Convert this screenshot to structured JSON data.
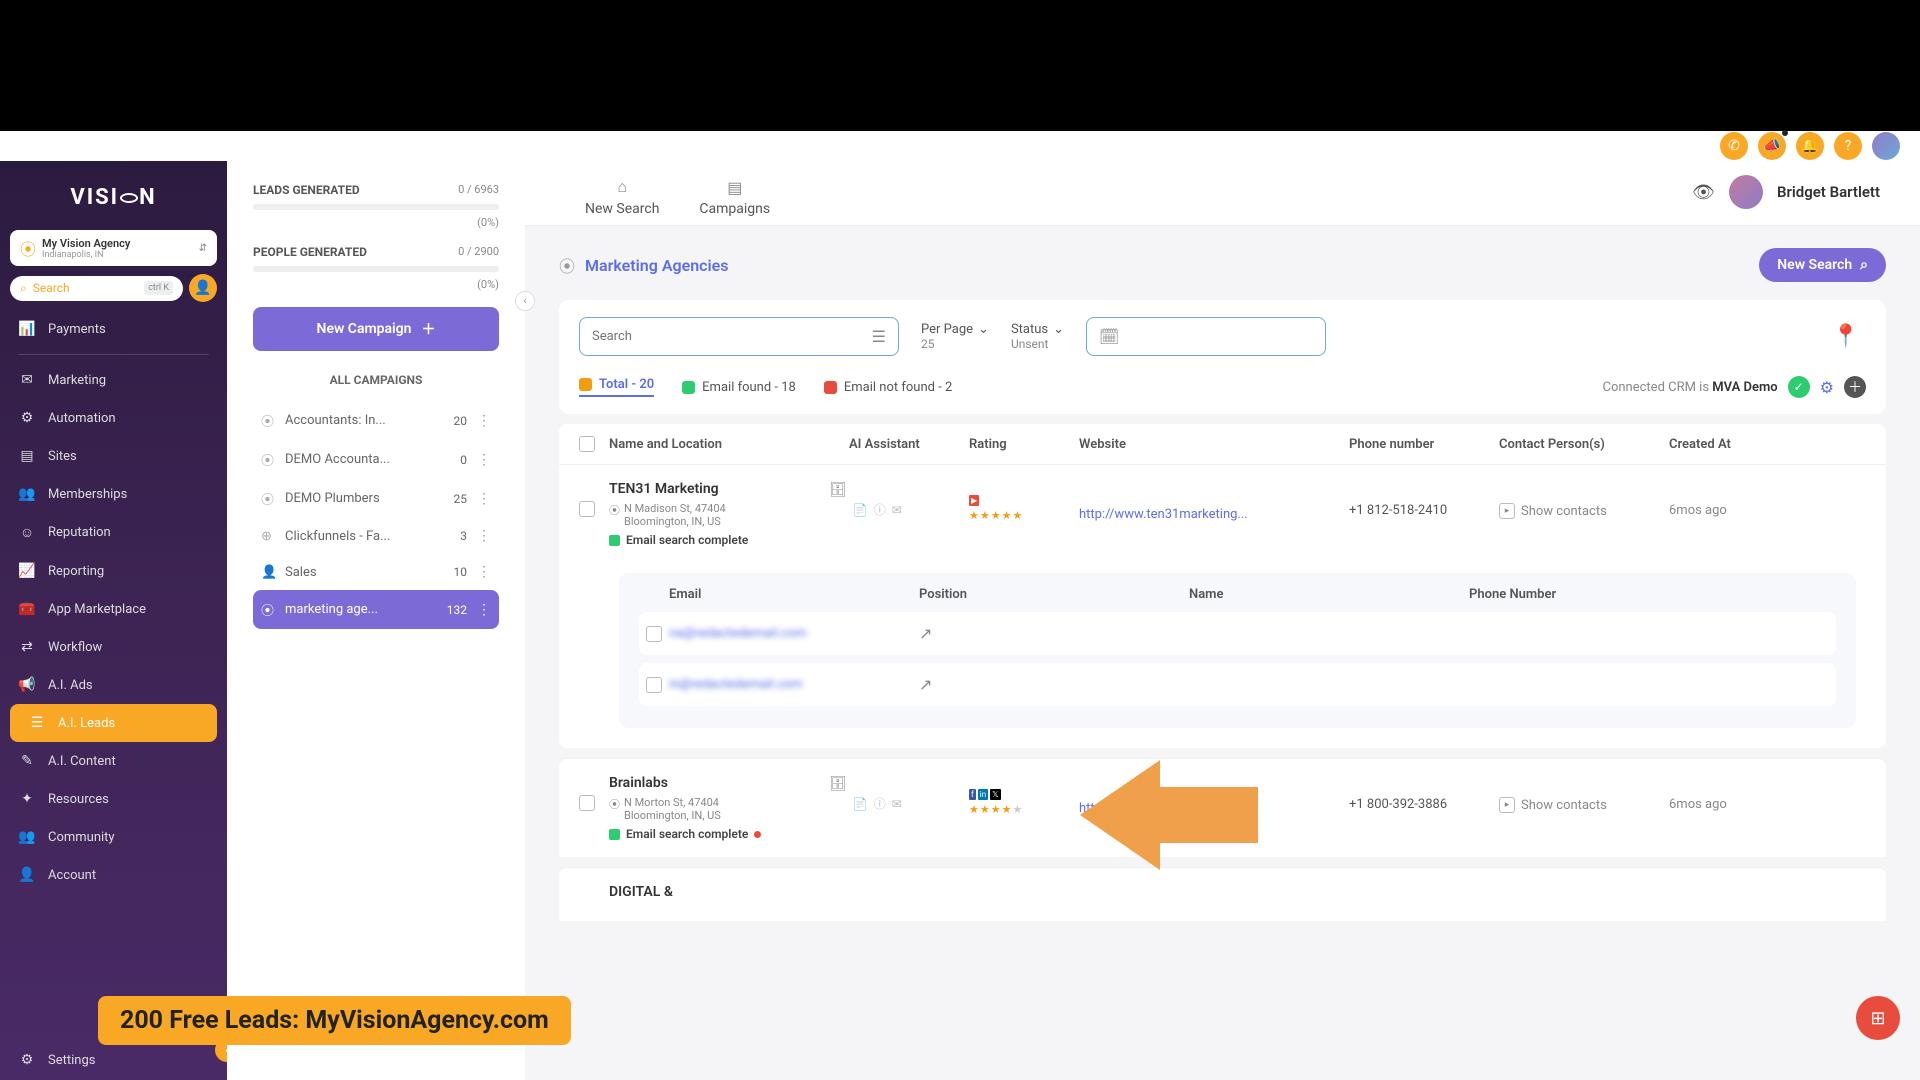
{
  "brand": "VISION",
  "agency": {
    "name": "My Vision Agency",
    "location": "Indianapolis, IN"
  },
  "search": {
    "placeholder": "Search",
    "shortcut": "ctrl K"
  },
  "nav": {
    "payments": "Payments",
    "marketing": "Marketing",
    "automation": "Automation",
    "sites": "Sites",
    "memberships": "Memberships",
    "reputation": "Reputation",
    "reporting": "Reporting",
    "marketplace": "App Marketplace",
    "workflow": "Workflow",
    "aiads": "A.I. Ads",
    "aileads": "A.I. Leads",
    "aicontent": "A.I. Content",
    "resources": "Resources",
    "community": "Community",
    "account": "Account",
    "settings": "Settings"
  },
  "campaigns_panel": {
    "leads_generated": {
      "label": "LEADS GENERATED",
      "value": "0 / 6963",
      "pct": "(0%)"
    },
    "people_generated": {
      "label": "PEOPLE GENERATED",
      "value": "0 / 2900",
      "pct": "(0%)"
    },
    "new_campaign": "New Campaign",
    "all_campaigns": "ALL CAMPAIGNS",
    "items": [
      {
        "label": "Accountants: In...",
        "count": "20"
      },
      {
        "label": "DEMO Accounta...",
        "count": "0"
      },
      {
        "label": "DEMO Plumbers",
        "count": "25"
      },
      {
        "label": "Clickfunnels - Fa...",
        "count": "3"
      },
      {
        "label": "Sales",
        "count": "10"
      },
      {
        "label": "marketing age...",
        "count": "132"
      }
    ]
  },
  "tabs": {
    "new_search": "New Search",
    "campaigns": "Campaigns"
  },
  "user": {
    "name": "Bridget Bartlett"
  },
  "page": {
    "title": "Marketing Agencies",
    "new_search_btn": "New Search"
  },
  "filters": {
    "search_placeholder": "Search",
    "per_page": {
      "label": "Per Page",
      "value": "25"
    },
    "status": {
      "label": "Status",
      "value": "Unsent"
    }
  },
  "stats": {
    "total": "Total - 20",
    "found": "Email found - 18",
    "notfound": "Email not found - 2",
    "crm_prefix": "Connected CRM is ",
    "crm_name": "MVA Demo"
  },
  "table": {
    "headers": {
      "name": "Name and Location",
      "ai": "AI Assistant",
      "rating": "Rating",
      "website": "Website",
      "phone": "Phone number",
      "contact": "Contact Person(s)",
      "created": "Created At"
    },
    "rows": [
      {
        "name": "TEN31 Marketing",
        "addr1": "N Madison St, 47404",
        "addr2": "Bloomington, IN, US",
        "status": "Email search complete",
        "website": "http://www.ten31marketing...",
        "phone": "+1 812-518-2410",
        "contact": "Show contacts",
        "created": "6mos ago"
      },
      {
        "name": "Brainlabs",
        "addr1": "N Morton St, 47404",
        "addr2": "Bloomington, IN, US",
        "status": "Email search complete",
        "website": "https://www.brainlabsdigit...",
        "phone": "+1 800-392-3886",
        "contact": "Show contacts",
        "created": "6mos ago"
      },
      {
        "name": "DIGITAL &"
      }
    ]
  },
  "expanded": {
    "headers": {
      "email": "Email",
      "position": "Position",
      "name": "Name",
      "phone": "Phone Number"
    },
    "rows": [
      {
        "email": "na@redactedemail.com"
      },
      {
        "email": "in@redactedemail.com"
      }
    ]
  },
  "promo": "200 Free Leads: MyVisionAgency.com"
}
